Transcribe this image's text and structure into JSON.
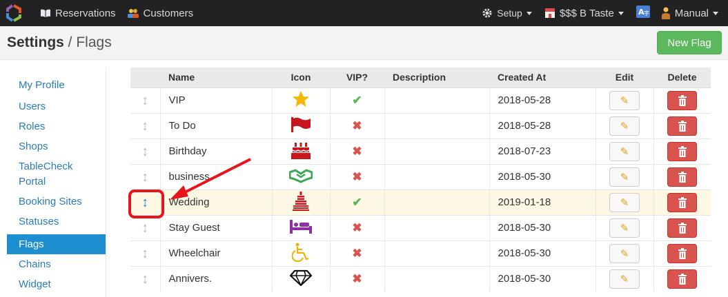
{
  "nav": {
    "reservations": "Reservations",
    "customers": "Customers",
    "setup": "Setup",
    "shop": "$$$ B Taste",
    "user": "Manual"
  },
  "header": {
    "title_bold": "Settings",
    "title_sep": " / ",
    "title_sub": "Flags",
    "new_flag": "New Flag"
  },
  "sidebar": {
    "items": [
      {
        "label": "My Profile"
      },
      {
        "label": "Users"
      },
      {
        "label": "Roles"
      },
      {
        "label": "Shops"
      },
      {
        "label": "TableCheck Portal"
      },
      {
        "label": "Booking Sites"
      },
      {
        "label": "Statuses"
      },
      {
        "label": "Flags"
      },
      {
        "label": "Chains"
      },
      {
        "label": "Widget"
      }
    ]
  },
  "table": {
    "columns": [
      "Name",
      "Icon",
      "VIP?",
      "Description",
      "Created At",
      "Edit",
      "Delete"
    ],
    "rows": [
      {
        "name": "VIP",
        "icon": "star-icon",
        "vip": true,
        "description": "",
        "created": "2018-05-28"
      },
      {
        "name": "To Do",
        "icon": "flag-icon",
        "vip": false,
        "description": "",
        "created": "2018-05-28"
      },
      {
        "name": "Birthday",
        "icon": "birthday-cake-icon",
        "vip": false,
        "description": "",
        "created": "2018-07-23"
      },
      {
        "name": "business",
        "icon": "handshake-icon",
        "vip": false,
        "description": "",
        "created": "2018-05-30"
      },
      {
        "name": "Wedding",
        "icon": "wedding-cake-icon",
        "vip": true,
        "description": "",
        "created": "2019-01-18"
      },
      {
        "name": "Stay Guest",
        "icon": "bed-icon",
        "vip": false,
        "description": "",
        "created": "2018-05-30"
      },
      {
        "name": "Wheelchair",
        "icon": "wheelchair-icon",
        "vip": false,
        "description": "",
        "created": "2018-05-30"
      },
      {
        "name": "Annivers.",
        "icon": "diamond-icon",
        "vip": false,
        "description": "",
        "created": "2018-05-30"
      }
    ]
  },
  "colors": {
    "navbar": "#222222",
    "link": "#2b7bb9",
    "active": "#1d8fd1",
    "success": "#5cb85c",
    "danger": "#d9534f",
    "highlight_row": "#fcf8e3",
    "annotation": "#e8141c"
  }
}
